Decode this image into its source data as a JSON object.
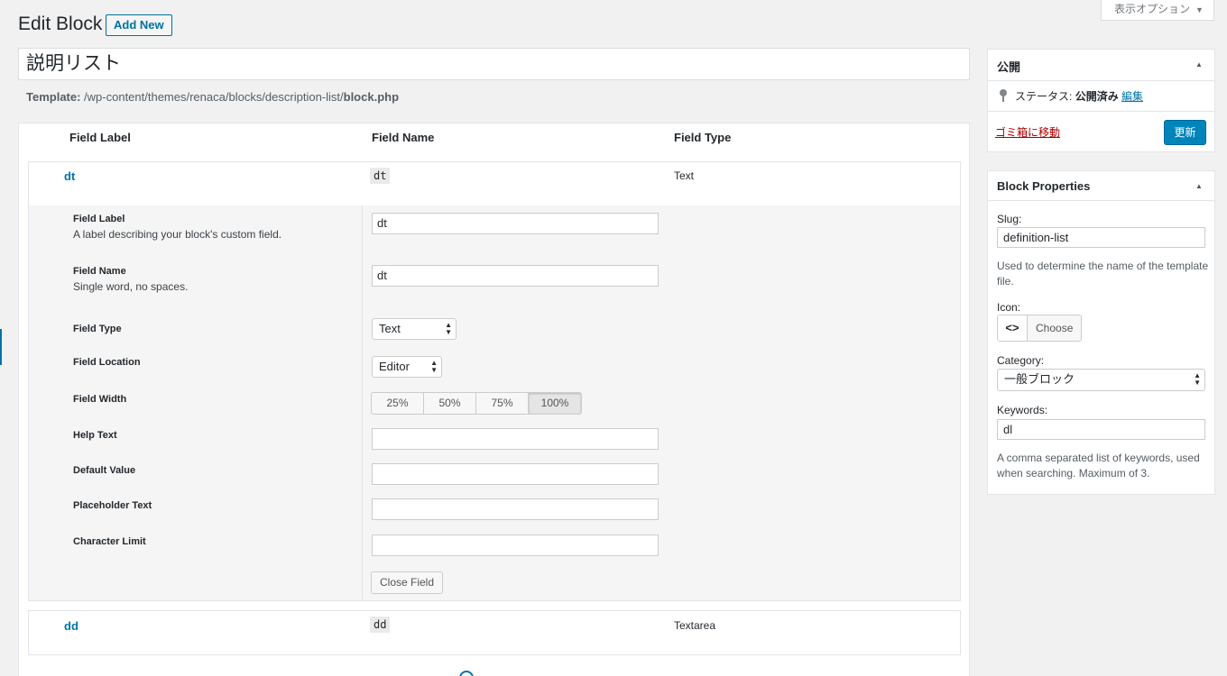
{
  "header": {
    "title": "Edit Block",
    "add_new_label": "Add New",
    "screen_options_label": "表示オプション"
  },
  "post": {
    "title": "説明リスト",
    "template_prefix": "Template:",
    "template_path": " /wp-content/themes/renaca/blocks/description-list/",
    "template_file": "block.php"
  },
  "fields_table": {
    "headers": [
      "Field Label",
      "Field Name",
      "Field Type"
    ],
    "rows": [
      {
        "label": "dt",
        "name": "dt",
        "type": "Text"
      },
      {
        "label": "dd",
        "name": "dd",
        "type": "Textarea"
      }
    ]
  },
  "field_settings": {
    "label_label": "Field Label",
    "label_desc": "A label describing your block's custom field.",
    "label_value": "dt",
    "name_label": "Field Name",
    "name_desc": "Single word, no spaces.",
    "name_value": "dt",
    "type_label": "Field Type",
    "type_value": "Text",
    "location_label": "Field Location",
    "location_value": "Editor",
    "width_label": "Field Width",
    "width_options": [
      "25%",
      "50%",
      "75%",
      "100%"
    ],
    "width_selected": "100%",
    "help_label": "Help Text",
    "default_label": "Default Value",
    "placeholder_label": "Placeholder Text",
    "charlimit_label": "Character Limit",
    "close_label": "Close Field"
  },
  "publish_panel": {
    "title": "公開",
    "status_prefix": "ステータス:",
    "status_value": "公開済み",
    "edit_link": "編集",
    "trash_link": "ゴミ箱に移動",
    "update_button": "更新"
  },
  "block_properties": {
    "title": "Block Properties",
    "slug_label": "Slug:",
    "slug_value": "definition-list",
    "slug_help": "Used to determine the name of the template file.",
    "icon_label": "Icon:",
    "icon_glyph": "<>",
    "choose_label": "Choose",
    "category_label": "Category:",
    "category_value": "一般ブロック",
    "keywords_label": "Keywords:",
    "keywords_value": "dl",
    "keywords_help": "A comma separated list of keywords, used when searching. Maximum of 3."
  }
}
